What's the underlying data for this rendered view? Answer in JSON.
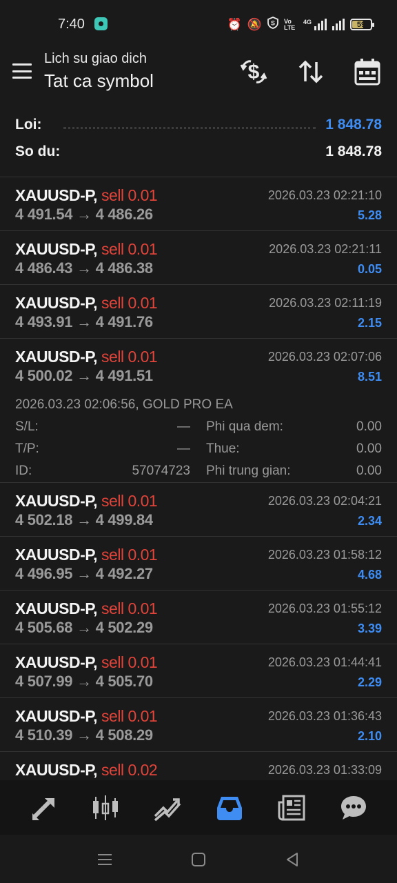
{
  "status_bar": {
    "time": "7:40",
    "network_label": "4G",
    "volte_label": "Vo LTE",
    "battery": "59"
  },
  "header": {
    "subtitle": "Lich su giao dich",
    "title": "Tat ca symbol",
    "icons": [
      "currency-exchange-icon",
      "sort-icon",
      "calendar-icon"
    ]
  },
  "summary": {
    "profit_label": "Loi:",
    "profit_value": "1 848.78",
    "balance_label": "So du:",
    "balance_value": "1 848.78",
    "accent": "#3f8df2"
  },
  "trades": [
    {
      "symbol": "XAUUSD-P,",
      "type": "sell 0.01",
      "open": "4 491.54",
      "close": "4 486.26",
      "time": "2026.03.23 02:21:10",
      "profit": "5.28"
    },
    {
      "symbol": "XAUUSD-P,",
      "type": "sell 0.01",
      "open": "4 486.43",
      "close": "4 486.38",
      "time": "2026.03.23 02:21:11",
      "profit": "0.05"
    },
    {
      "symbol": "XAUUSD-P,",
      "type": "sell 0.01",
      "open": "4 493.91",
      "close": "4 491.76",
      "time": "2026.03.23 02:11:19",
      "profit": "2.15"
    },
    {
      "symbol": "XAUUSD-P,",
      "type": "sell 0.01",
      "open": "4 500.02",
      "close": "4 491.51",
      "time": "2026.03.23 02:07:06",
      "profit": "8.51",
      "details": {
        "open_info": "2026.03.23 02:06:56, GOLD PRO EA",
        "sl_label": "S/L:",
        "sl_value": "—",
        "tp_label": "T/P:",
        "tp_value": "—",
        "id_label": "ID:",
        "id_value": "57074723",
        "swap_label": "Phi qua dem:",
        "swap_value": "0.00",
        "tax_label": "Thue:",
        "tax_value": "0.00",
        "commission_label": "Phi trung gian:",
        "commission_value": "0.00"
      }
    },
    {
      "symbol": "XAUUSD-P,",
      "type": "sell 0.01",
      "open": "4 502.18",
      "close": "4 499.84",
      "time": "2026.03.23 02:04:21",
      "profit": "2.34"
    },
    {
      "symbol": "XAUUSD-P,",
      "type": "sell 0.01",
      "open": "4 496.95",
      "close": "4 492.27",
      "time": "2026.03.23 01:58:12",
      "profit": "4.68"
    },
    {
      "symbol": "XAUUSD-P,",
      "type": "sell 0.01",
      "open": "4 505.68",
      "close": "4 502.29",
      "time": "2026.03.23 01:55:12",
      "profit": "3.39"
    },
    {
      "symbol": "XAUUSD-P,",
      "type": "sell 0.01",
      "open": "4 507.99",
      "close": "4 505.70",
      "time": "2026.03.23 01:44:41",
      "profit": "2.29"
    },
    {
      "symbol": "XAUUSD-P,",
      "type": "sell 0.01",
      "open": "4 510.39",
      "close": "4 508.29",
      "time": "2026.03.23 01:36:43",
      "profit": "2.10"
    },
    {
      "symbol": "XAUUSD-P,",
      "type": "sell 0.02",
      "open": "",
      "close": "",
      "time": "2026.03.23 01:33:09",
      "profit": ""
    }
  ],
  "arrow": "→",
  "bottom_nav": {
    "items": [
      "quotes-icon",
      "chart-icon",
      "trade-icon",
      "history-icon",
      "news-icon",
      "messages-icon"
    ],
    "active": "history-icon"
  },
  "system_nav": [
    "menu-icon",
    "home-icon",
    "back-icon"
  ]
}
